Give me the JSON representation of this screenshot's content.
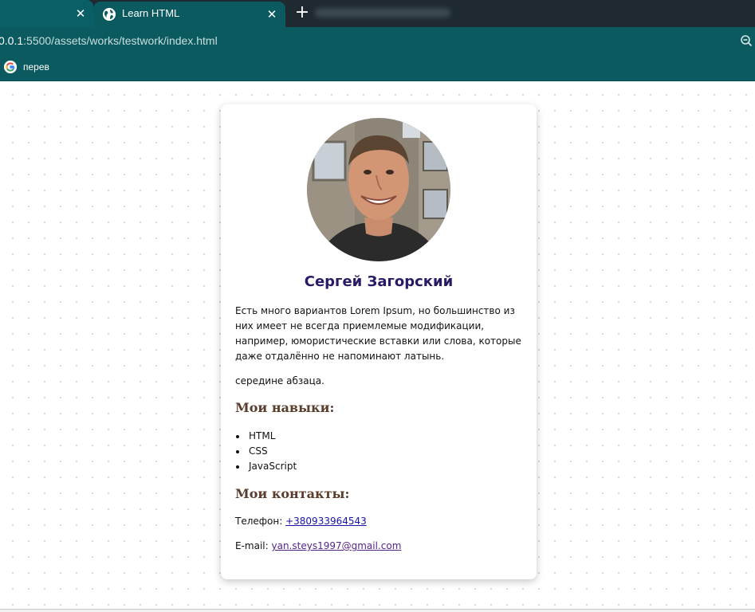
{
  "browser": {
    "active_tab_title": "Learn HTML",
    "new_tab_symbol": "+",
    "close_symbol": "✕",
    "url_host": "0.0.1",
    "url_path": ":5500/assets/works/testwork/index.html",
    "bookmark_label": "перев",
    "accent_color": "#0b5a60"
  },
  "profile": {
    "name": "Сергей Загорский",
    "about": "Есть много вариантов Lorem Ipsum, но большинство из них имеет не всегда приемлемые модификации, например, юмористические вставки или слова, которые даже отдалённо не напоминают латынь.",
    "about_tail": "середине абзаца.",
    "skills_heading": "Мои навыки:",
    "skills": [
      "HTML",
      "CSS",
      "JavaScript"
    ],
    "contacts_heading": "Мои контакты:",
    "phone_label": "Телефон:",
    "phone": "+380933964543",
    "email_label": "E-mail:",
    "email": "yan.steys1997@gmail.com"
  }
}
